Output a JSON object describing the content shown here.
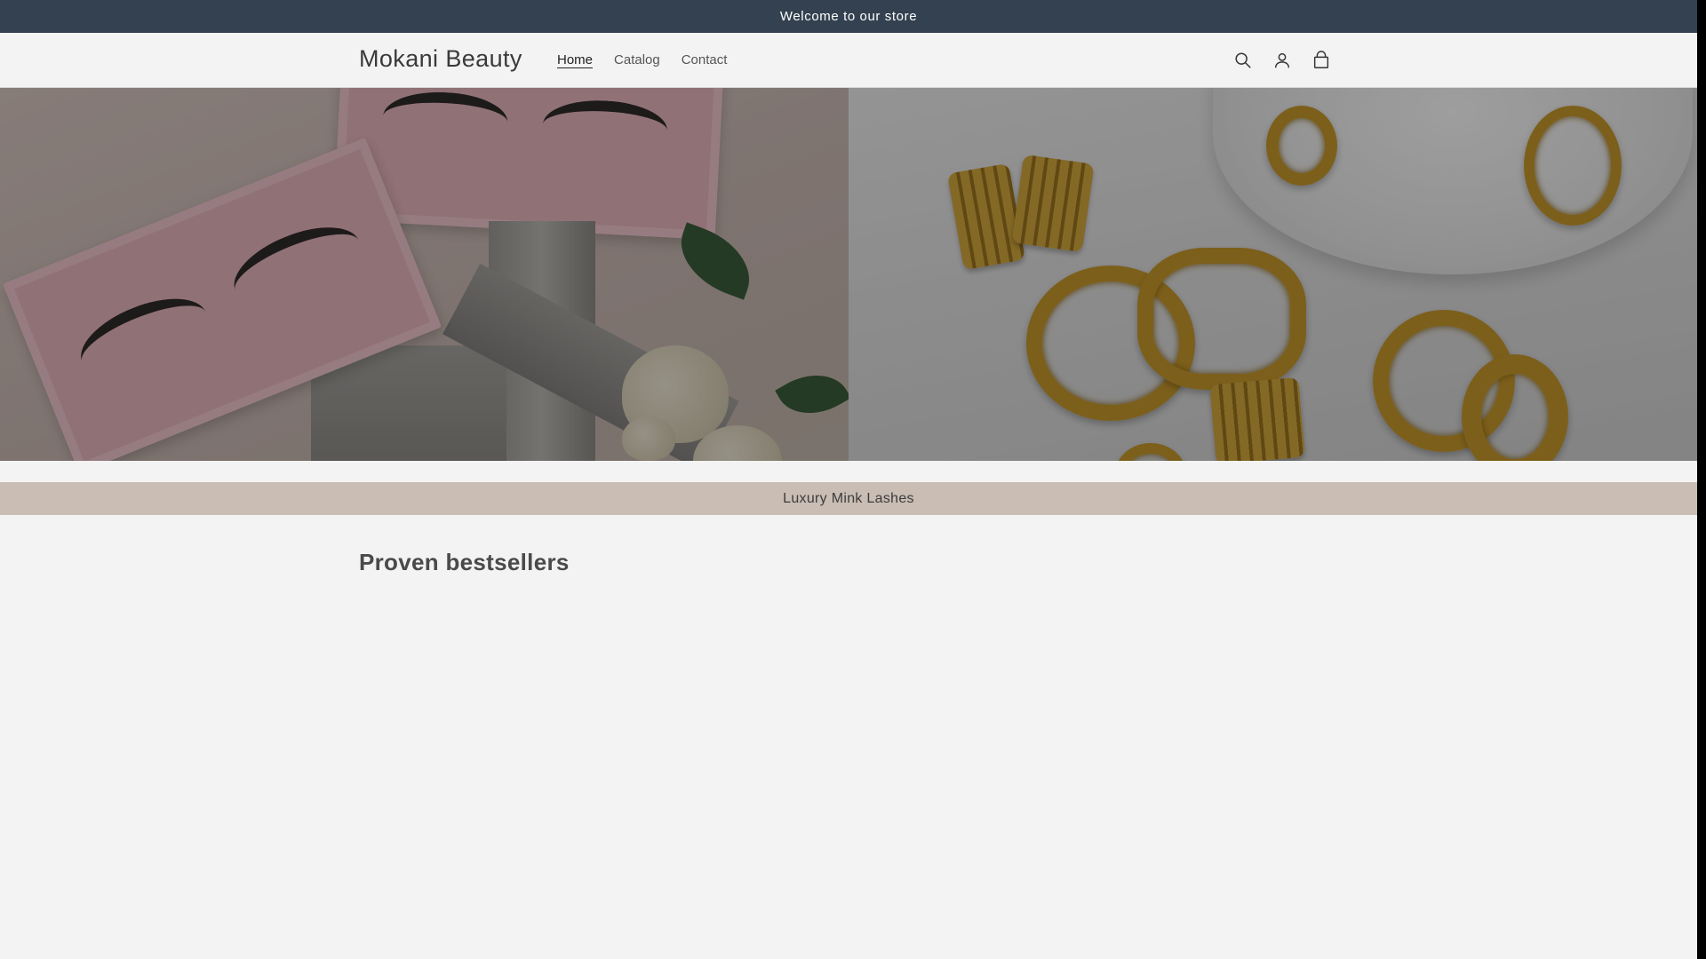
{
  "announcement": {
    "text": "Welcome to our store"
  },
  "header": {
    "logo": "Mokani Beauty",
    "nav": [
      {
        "label": "Home",
        "active": true
      },
      {
        "label": "Catalog",
        "active": false
      },
      {
        "label": "Contact",
        "active": false
      }
    ],
    "icons": [
      "search-icon",
      "account-icon",
      "cart-icon"
    ]
  },
  "hero": {
    "left_image": "lashes-image",
    "right_image": "earrings-image"
  },
  "band": {
    "text": "Luxury Mink Lashes"
  },
  "section": {
    "title": "Proven bestsellers"
  },
  "colors": {
    "announcement_bg": "#334150",
    "band_bg": "#c9bdb4",
    "page_bg": "#f3f3f3"
  }
}
